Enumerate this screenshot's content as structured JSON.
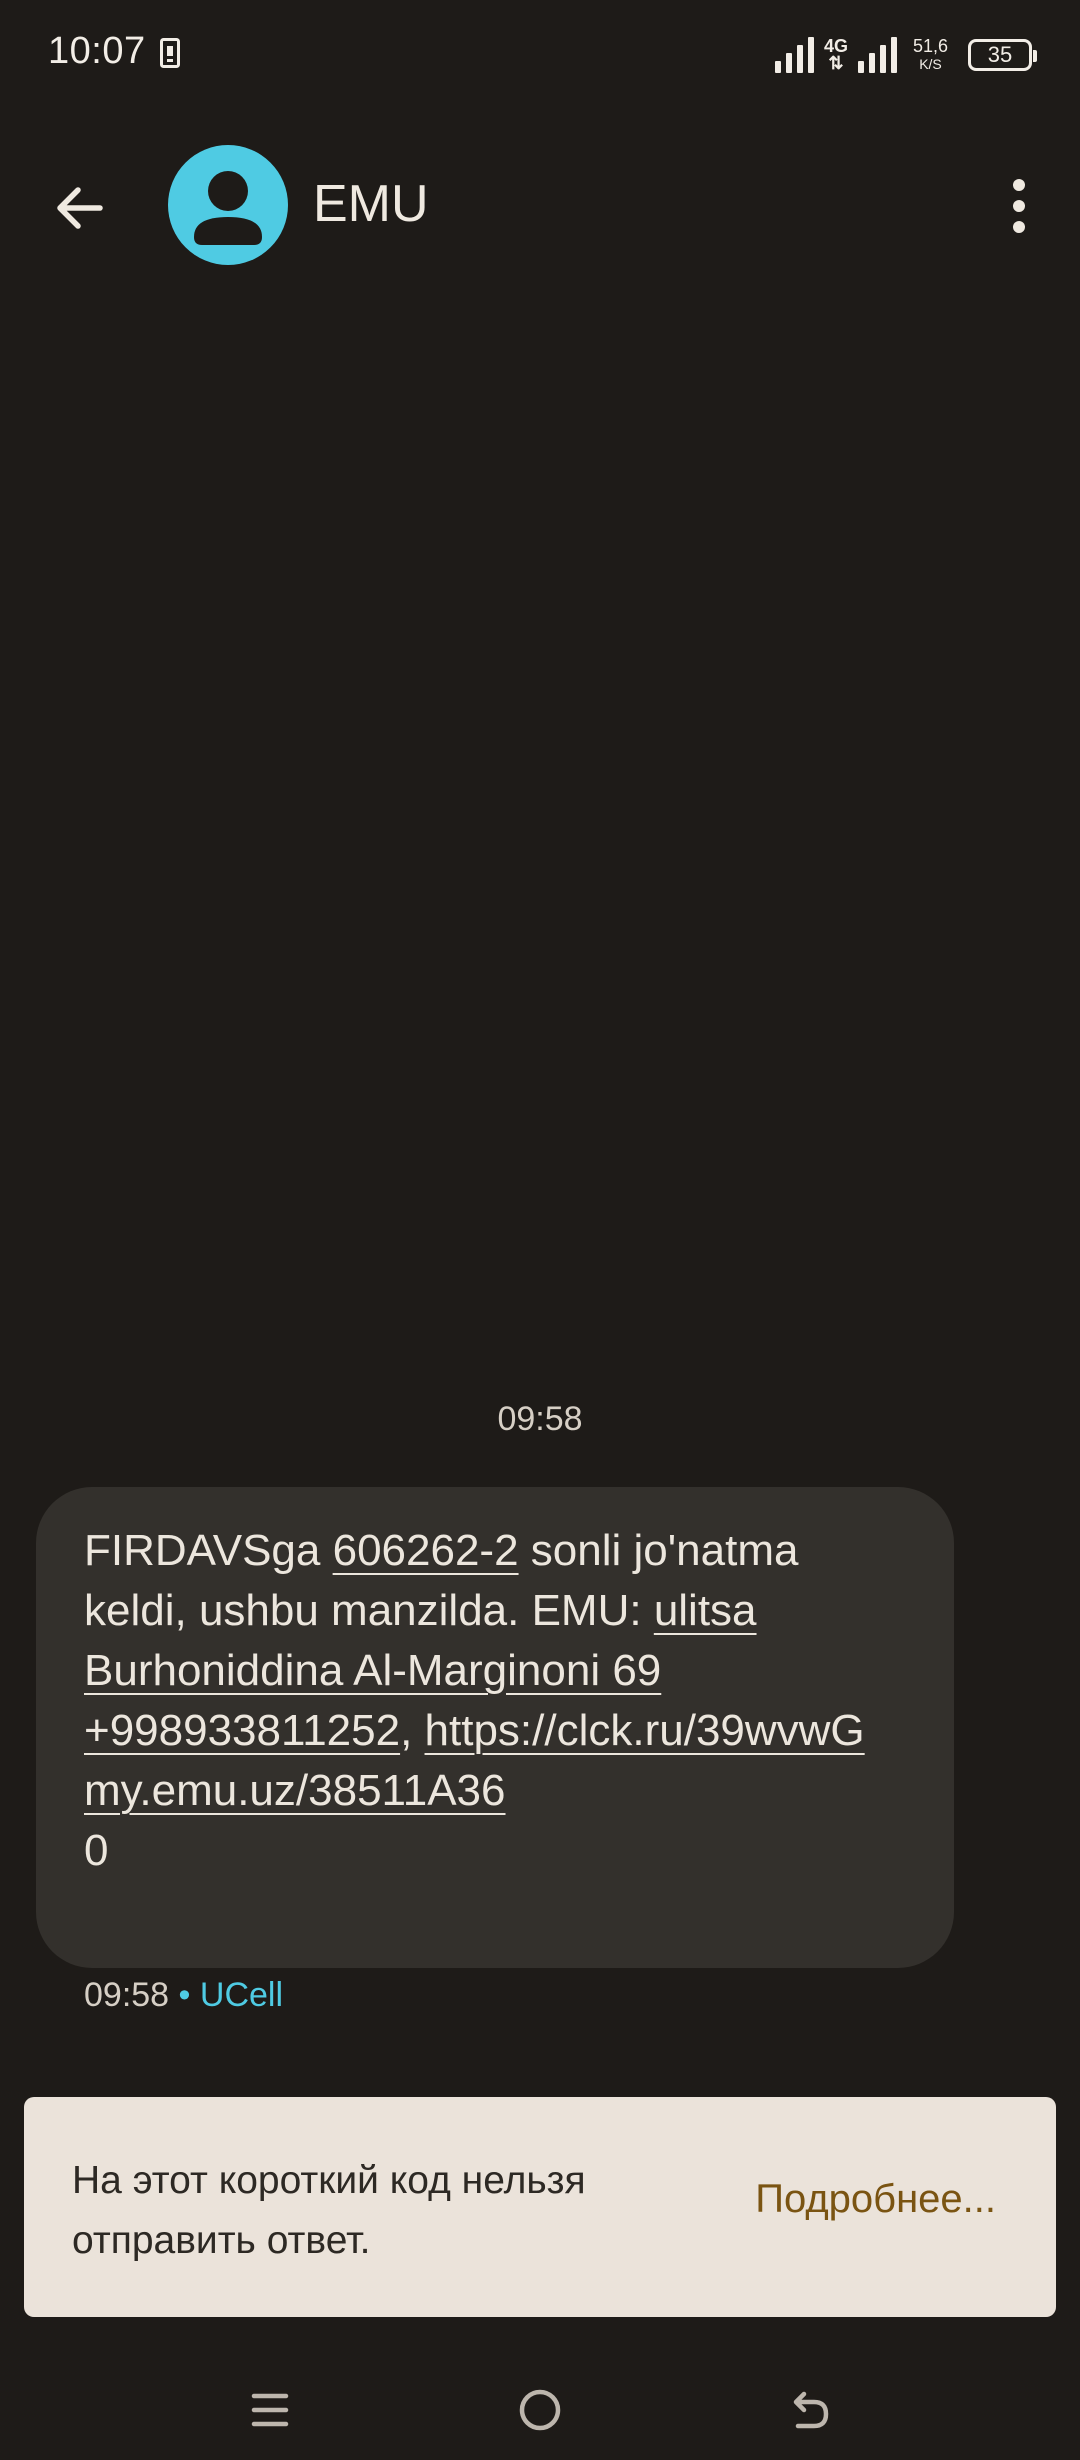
{
  "status_bar": {
    "time": "10:07",
    "network_type": "4G",
    "speed_value": "51,6",
    "speed_unit": "K/S",
    "battery_level": "35"
  },
  "header": {
    "contact_name": "EMU"
  },
  "conversation": {
    "divider_time": "09:58",
    "message": {
      "parts": {
        "p1": "FIRDAVSga ",
        "tracking": "606262-2",
        "p2": " sonli jo'natma keldi, ushbu manzilda. EMU: ",
        "address": "ulitsa Burhoniddina Al-Marginoni 69",
        "phone": "+998933811252",
        "comma": ", ",
        "url1": "https://clck.ru/39wvwG",
        "url2": "my.emu.uz/38511A36",
        "tail": "0"
      },
      "time": "09:58",
      "separator": " • ",
      "sim": "UCell"
    }
  },
  "banner": {
    "text": "На этот короткий код нельзя отправить ответ.",
    "link_label": "Подробнее..."
  },
  "colors": {
    "background": "#1e1b18",
    "bubble": "#33302c",
    "avatar": "#4fcbe3",
    "banner": "#ebe3da",
    "banner_link": "#7a5412"
  }
}
